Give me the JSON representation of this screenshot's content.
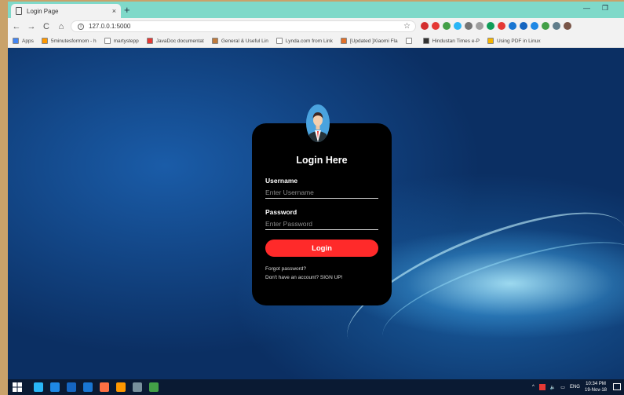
{
  "browser": {
    "tab_title": "Login Page",
    "tab_close": "×",
    "new_tab": "+",
    "minimize": "—",
    "restore": "❐",
    "url": "127.0.0.1:5000",
    "info": "i",
    "star": "☆",
    "nav": {
      "back": "←",
      "forward": "→",
      "reload": "C",
      "home": "⌂"
    },
    "bookmarks": [
      {
        "label": "Apps",
        "color": "#4285f4"
      },
      {
        "label": "5minutesformom - h",
        "color": "#ff9800"
      },
      {
        "label": "martystepp",
        "color": "#ffffff"
      },
      {
        "label": "JavaDoc documentat",
        "color": "#e53935"
      },
      {
        "label": "General & Useful Lin",
        "color": "#bf7b3d"
      },
      {
        "label": "Lynda.com from Link",
        "color": "#ffffff"
      },
      {
        "label": "[Updated ]Xiaomi Fla",
        "color": "#e0702a"
      },
      {
        "label": "",
        "color": "#ffffff"
      },
      {
        "label": "Hindustan Times e-P",
        "color": "#333333"
      },
      {
        "label": "Using PDF in Linux",
        "color": "#f5b400"
      }
    ],
    "extension_colors": [
      "#d32f2f",
      "#e53935",
      "#43a047",
      "#29b6f6",
      "#757575",
      "#9e9e9e",
      "#0f9d58",
      "#e53935",
      "#1976d2",
      "#1565c0",
      "#1e88e5",
      "#43a047",
      "#607d8b",
      "#795548"
    ]
  },
  "login": {
    "title": "Login Here",
    "username_label": "Username",
    "username_placeholder": "Enter Username",
    "password_label": "Password",
    "password_placeholder": "Enter Password",
    "button_label": "Login",
    "forgot_link": "Forgot password?",
    "signup_link": "Don't have an account? SIGN UP!"
  },
  "taskbar": {
    "icon_colors": [
      "#29b6f6",
      "#1e88e5",
      "#1565c0",
      "#1976d2",
      "#ff7043",
      "#ff9800",
      "#78909c",
      "#43a047"
    ],
    "language": "ENG",
    "time": "10:34 PM",
    "date": "19-Nov-18"
  }
}
